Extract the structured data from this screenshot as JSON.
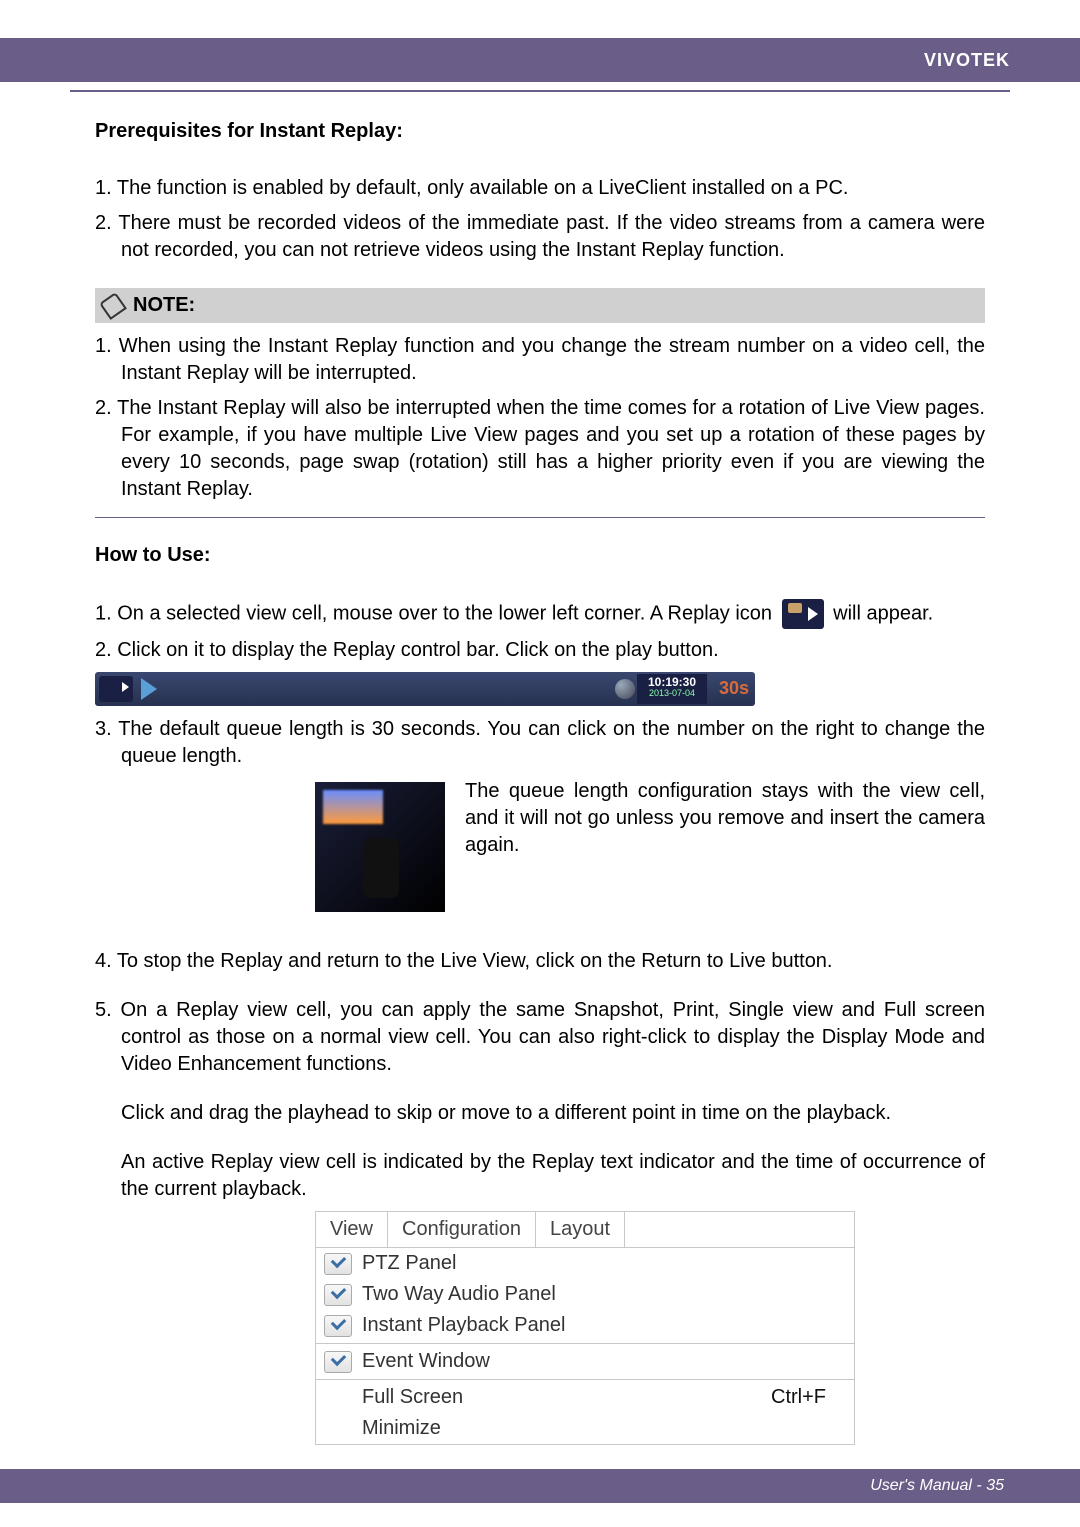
{
  "brand": "VIVOTEK",
  "sections": {
    "prereq_title": "Prerequisites for Instant Replay:",
    "prereq": [
      "1. The function is enabled by default, only available on a LiveClient installed on a PC.",
      "2. There must be recorded videos of the immediate past. If the video streams from a camera were not recorded, you can not retrieve videos using the Instant Replay function."
    ],
    "note_label": "NOTE:",
    "notes": [
      "1. When using the Instant Replay function and you change the stream number on a video cell, the Instant Replay will be interrupted.",
      "2. The Instant Replay will also be interrupted when the time comes for a rotation of Live View pages. For example, if you have multiple Live View pages and you set up a rotation of these pages by every 10 seconds, page swap (rotation) still has a higher priority even if you are viewing the Instant Replay."
    ],
    "howto_title": "How to Use:",
    "howto1_pre": "1. On a selected view cell, mouse over to the lower left corner. A Replay icon ",
    "howto1_post": " will appear.",
    "howto2": "2. Click on it to display the Replay control bar. Click on the play button.",
    "howto3": "3. The default queue length is 30 seconds. You can click on the number on the right to change the queue length.",
    "queue_desc": "The queue length configuration stays with the view cell, and it will not go unless you remove and insert the camera again.",
    "howto4": "4. To stop the Replay and return to the Live View, click on the Return to Live button.",
    "howto5": "5. On a Replay view cell, you can apply the same Snapshot, Print, Single view and Full screen control as those on a normal view cell. You can also right-click to display the Display Mode and Video Enhancement functions.",
    "playhead": "Click and drag the playhead to skip or move to a different point in time on the playback.",
    "active_replay": "An active Replay view cell is indicated by the Replay text indicator and the time of occurrence of the current playback."
  },
  "replay_bar": {
    "time": "10:19:30",
    "date": "2013-07-04",
    "queue": "30s"
  },
  "menu": {
    "tabs": [
      "View",
      "Configuration",
      "Layout"
    ],
    "items": [
      {
        "checked": true,
        "label": "PTZ Panel",
        "accel": ""
      },
      {
        "checked": true,
        "label": "Two Way Audio Panel",
        "accel": ""
      },
      {
        "checked": true,
        "label": "Instant Playback Panel",
        "accel": ""
      }
    ],
    "items2": [
      {
        "checked": true,
        "label": "Event Window",
        "accel": ""
      }
    ],
    "items3": [
      {
        "checked": false,
        "label": "Full Screen",
        "accel": "Ctrl+F"
      },
      {
        "checked": false,
        "label": "Minimize",
        "accel": ""
      }
    ]
  },
  "footer": "User's Manual - 35"
}
